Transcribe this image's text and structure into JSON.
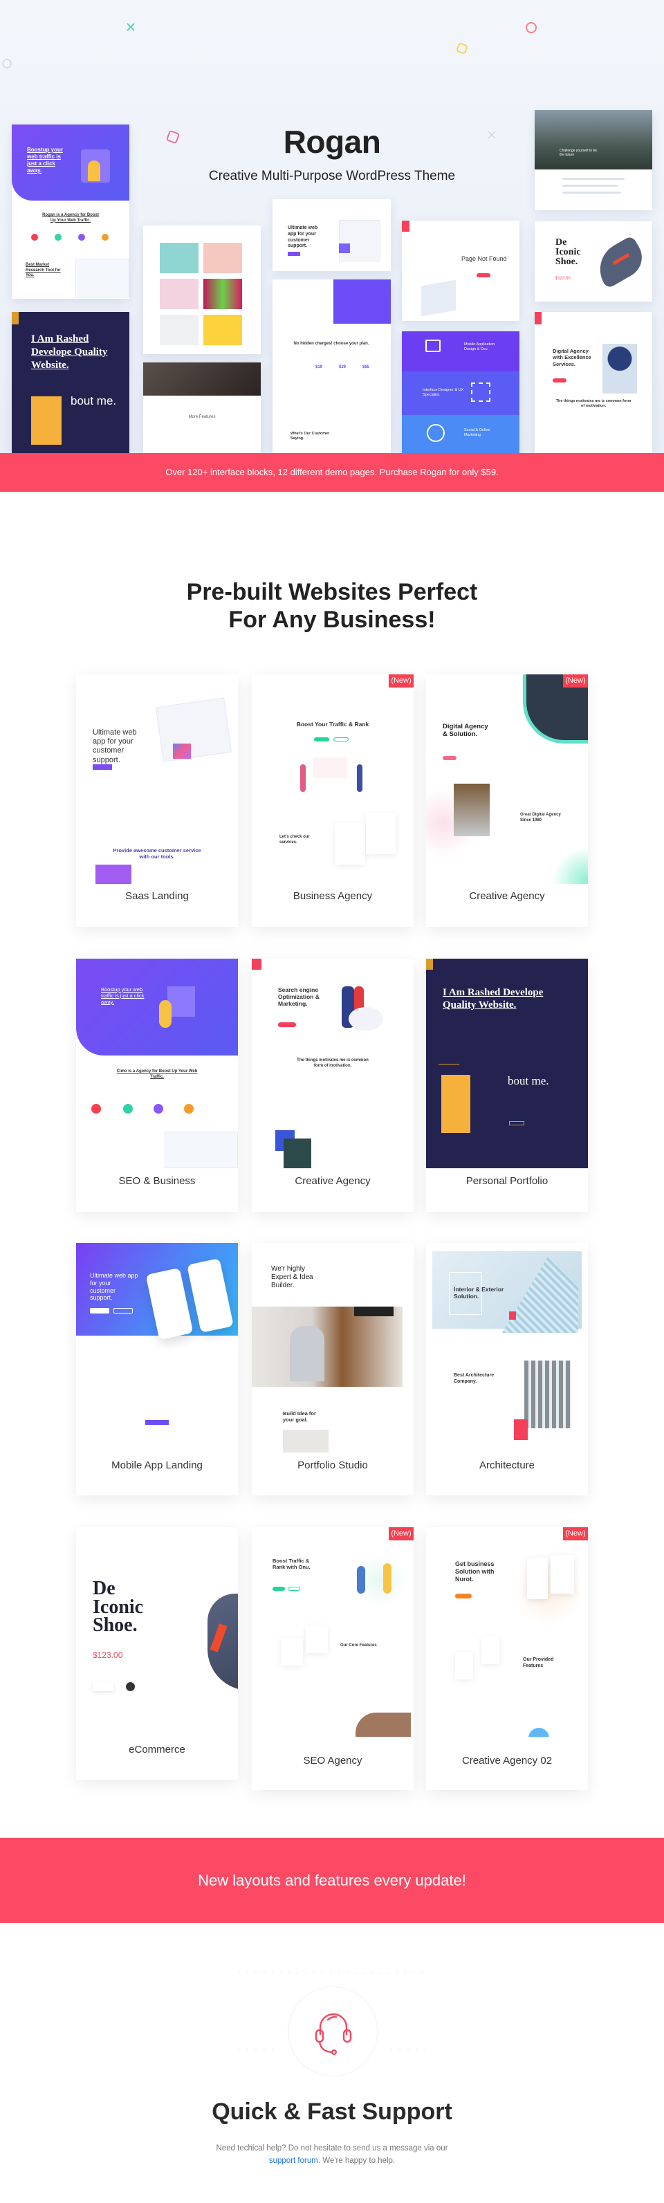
{
  "hero": {
    "title": "Rogan",
    "subtitle": "Creative Multi-Purpose WordPress Theme",
    "previews": {
      "seo_headline": "Boostup your web traffic is just a click away.",
      "seo_sub": "Rogan is a Agency for Boost Up Your Web Traffic.",
      "seo_sub2": "Best Market Research Tool for You.",
      "portfolio_headline": "I Am Rashed Develope Quality Website.",
      "portfolio_about": "bout me.",
      "gallery_feature": "More Features",
      "saas_headline": "Ultimate web app for your customer support.",
      "pricing_headline": "No hidden charges! choose your plan.",
      "pricing_values": [
        "$19",
        "$39",
        "$65"
      ],
      "testimonial": "What's Our Customer Saying.",
      "error_title": "Page Not Found",
      "service_1": "Mobile Application Design & Dev.",
      "service_2": "Interface Designer & UX Specialist.",
      "service_3": "Social & Online Marketing",
      "mountain_headline": "Challenge yourself to be the future",
      "shoe_headline": "De Iconic Shoe.",
      "shoe_price": "$123.00",
      "agency_headline": "Digital Agency with Excellence Services.",
      "agency_sub": "The things motivates me is common form of motivation."
    }
  },
  "promo_banner": "Over 120+ interface blocks, 12 different demo pages. Purchase Rogan for only $59.",
  "section": {
    "title_line1": "Pre-built Websites Perfect",
    "title_line2": "For Any Business!"
  },
  "new_badge": "(New)",
  "demos": [
    {
      "label": "Saas Landing",
      "is_new": false,
      "headline": "Ultimate web app for your customer support.",
      "sub": "Provide awesome customer service with our tools."
    },
    {
      "label": "Business Agency",
      "is_new": true,
      "headline": "Boost Your Traffic & Rank",
      "sub": "Let's check our services."
    },
    {
      "label": "Creative Agency",
      "is_new": true,
      "headline": "Digital Agency & Solution.",
      "sub": "Great Digital Agency Since 1980"
    },
    {
      "label": "SEO & Business",
      "is_new": false,
      "headline": "Boostup your web traffic is just a click away.",
      "sub": "Cimo is a Agency for Boost Up Your Web Traffic."
    },
    {
      "label": "Creative Agency",
      "is_new": false,
      "headline": "Search engine Optimization & Marketing.",
      "sub": "The things motivates me is common form of motivation."
    },
    {
      "label": "Personal Portfolio",
      "is_new": false,
      "headline": "I Am Rashed Develope Quality Website.",
      "sub": "bout me."
    },
    {
      "label": "Mobile App Landing",
      "is_new": false,
      "headline": "Ultimate web app for your customer support.",
      "sub": ""
    },
    {
      "label": "Portfolio Studio",
      "is_new": false,
      "headline": "We'r highly Expert & Idea Builder.",
      "sub": "Build Idea for your goal."
    },
    {
      "label": "Architecture",
      "is_new": false,
      "headline": "Interior & Exterior Solution.",
      "sub": "Best Architecture Company."
    },
    {
      "label": "eCommerce",
      "is_new": false,
      "headline": "De Iconic Shoe.",
      "sub": "$123.00"
    },
    {
      "label": "SEO Agency",
      "is_new": true,
      "headline": "Boost Traffic & Rank with Onu.",
      "sub": "Our Core Features"
    },
    {
      "label": "Creative Agency 02",
      "is_new": true,
      "headline": "Get business Solution with Nurot.",
      "sub": "Our Provided Features"
    }
  ],
  "update_banner": "New layouts and features every update!",
  "support": {
    "icon": "headset-icon",
    "title": "Quick & Fast Support",
    "text": "Need techical help? Do not hesitate to send us a message via our",
    "link": "support forum",
    "text_after": ". We're happy to help."
  },
  "colors": {
    "accent": "#fd4a64",
    "badge": "#f6404f",
    "link": "#1a73e8",
    "purple": "#6b4cf6",
    "navy": "#24234f"
  }
}
